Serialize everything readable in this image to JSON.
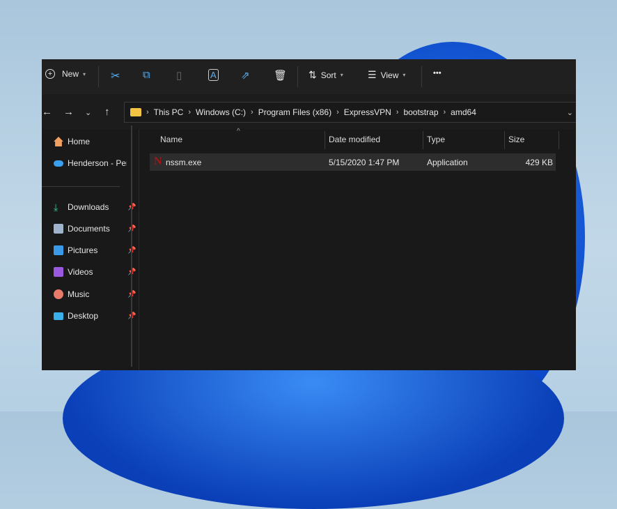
{
  "toolbar": {
    "new_label": "New",
    "sort_label": "Sort",
    "view_label": "View",
    "more": "•••"
  },
  "address": {
    "segments": [
      "This PC",
      "Windows (C:)",
      "Program Files (x86)",
      "ExpressVPN",
      "bootstrap",
      "amd64"
    ]
  },
  "sidebar": {
    "items": [
      {
        "label": "Home",
        "icon": "home-icon",
        "color": "#f0a060"
      },
      {
        "label": "Henderson - Per",
        "icon": "cloud-icon",
        "color": "#3aa0f0"
      },
      {
        "label": "Downloads",
        "icon": "download-icon",
        "color": "#3cc8a0",
        "pinned": true
      },
      {
        "label": "Documents",
        "icon": "document-icon",
        "color": "#9fb4cc",
        "pinned": true
      },
      {
        "label": "Pictures",
        "icon": "pictures-icon",
        "color": "#3a9ae8",
        "pinned": true
      },
      {
        "label": "Videos",
        "icon": "videos-icon",
        "color": "#9a5ae0",
        "pinned": true
      },
      {
        "label": "Music",
        "icon": "music-icon",
        "color": "#e87a6a",
        "pinned": true
      },
      {
        "label": "Desktop",
        "icon": "desktop-icon",
        "color": "#3ab0e8",
        "pinned": true
      }
    ]
  },
  "columns": [
    "Name",
    "Date modified",
    "Type",
    "Size"
  ],
  "files": [
    {
      "name": "nssm.exe",
      "date": "5/15/2020 1:47 PM",
      "type": "Application",
      "size": "429 KB"
    }
  ]
}
